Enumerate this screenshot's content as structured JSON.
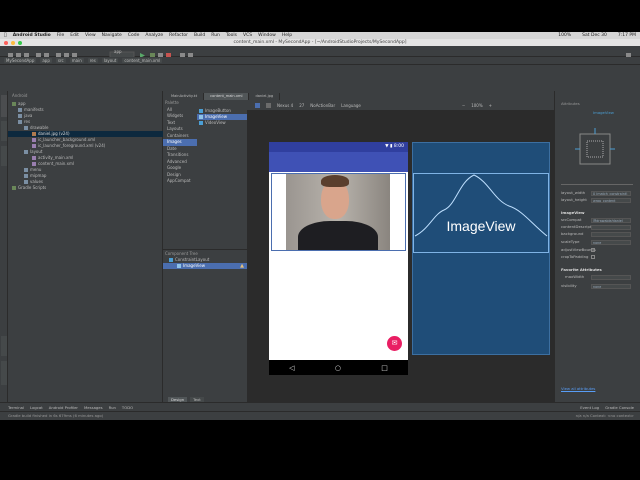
{
  "menubar": {
    "items": [
      "Android Studio",
      "File",
      "Edit",
      "View",
      "Navigate",
      "Code",
      "Analyze",
      "Refactor",
      "Build",
      "Run",
      "Tools",
      "VCS",
      "Window",
      "Help"
    ],
    "right": [
      "100%",
      "Sat Dec 30",
      "7:17 PM"
    ]
  },
  "window": {
    "title": "content_main.xml - MySecondApp - [~/AndroidStudioProjects/MySecondApp]"
  },
  "toolbar": {
    "run_config": "app"
  },
  "nav": {
    "crumbs": [
      "MySecondApp",
      "app",
      "src",
      "main",
      "res",
      "layout",
      "content_main.xml"
    ]
  },
  "editor_tabs": [
    {
      "label": "MainActivity.kt",
      "active": false
    },
    {
      "label": "content_main.xml",
      "active": true
    },
    {
      "label": "daniel.jpg",
      "active": false
    }
  ],
  "project": {
    "dropdown": "Android",
    "rows": [
      {
        "label": "app",
        "indent": 0
      },
      {
        "label": "manifests",
        "indent": 1
      },
      {
        "label": "java",
        "indent": 1
      },
      {
        "label": "res",
        "indent": 1
      },
      {
        "label": "drawable",
        "indent": 2
      },
      {
        "label": "daniel.jpg (v24)",
        "indent": 3,
        "selected": true
      },
      {
        "label": "ic_launcher_background.xml",
        "indent": 3
      },
      {
        "label": "ic_launcher_foreground.xml (v24)",
        "indent": 3
      },
      {
        "label": "layout",
        "indent": 2
      },
      {
        "label": "activity_main.xml",
        "indent": 3
      },
      {
        "label": "content_main.xml",
        "indent": 3
      },
      {
        "label": "menu",
        "indent": 2
      },
      {
        "label": "mipmap",
        "indent": 2
      },
      {
        "label": "values",
        "indent": 2
      },
      {
        "label": "Gradle Scripts",
        "indent": 0
      }
    ]
  },
  "palette": {
    "title": "Palette",
    "categories": [
      "All",
      "Widgets",
      "Text",
      "Layouts",
      "Containers",
      "Images",
      "Date",
      "Transitions",
      "Advanced",
      "Google",
      "Design",
      "AppCompat"
    ],
    "selected_category": "Images",
    "items": [
      "ImageButton",
      "ImageView",
      "VideoView"
    ],
    "selected_item": "ImageView"
  },
  "component_tree": {
    "title": "Component Tree",
    "rows": [
      "ConstraintLayout",
      "ImageView"
    ]
  },
  "design_toolbar": {
    "device": "Nexus 4",
    "api": "27",
    "theme": "NoActionBar",
    "language": "Language",
    "zoom": "100%"
  },
  "phone": {
    "time": "8:00",
    "nav_buttons": [
      "◁",
      "○",
      "□"
    ],
    "fab_icon": "✉"
  },
  "blueprint": {
    "label": "ImageView"
  },
  "attributes": {
    "title": "Attributes",
    "component": "ImageView",
    "rows": [
      {
        "label": "layout_width",
        "value": "0 (match_constraint)"
      },
      {
        "label": "layout_height",
        "value": "wrap_content"
      },
      {
        "label": "ImageView",
        "value": ""
      },
      {
        "label": "srcCompat",
        "value": "@drawable/daniel"
      },
      {
        "label": "contentDescription",
        "value": ""
      },
      {
        "label": "background",
        "value": ""
      },
      {
        "label": "scaleType",
        "value": "none"
      },
      {
        "label": "adjustViewBounds",
        "value": ""
      },
      {
        "label": "cropToPadding",
        "value": ""
      },
      {
        "label": "Favorite Attributes",
        "value": ""
      },
      {
        "label": "maxWidth",
        "value": ""
      },
      {
        "label": "visibility",
        "value": "none"
      }
    ],
    "view_all": "View all attributes"
  },
  "bottom_tabs": [
    "Terminal",
    "Logcat",
    "Android Profiler",
    "Messages",
    "Run",
    "TODO"
  ],
  "bottom_right": [
    "Event Log",
    "Gradle Console"
  ],
  "design_tabs": [
    "Design",
    "Text"
  ],
  "status": {
    "message": "Gradle build finished in 6s 679ms (6 minutes ago)",
    "right": "n/a   n/a   Context: <no context>"
  },
  "colors": {
    "primary": "#3f51b5",
    "primary_dark": "#303f9f",
    "accent": "#e91e63",
    "blueprint": "#1f4d78"
  }
}
